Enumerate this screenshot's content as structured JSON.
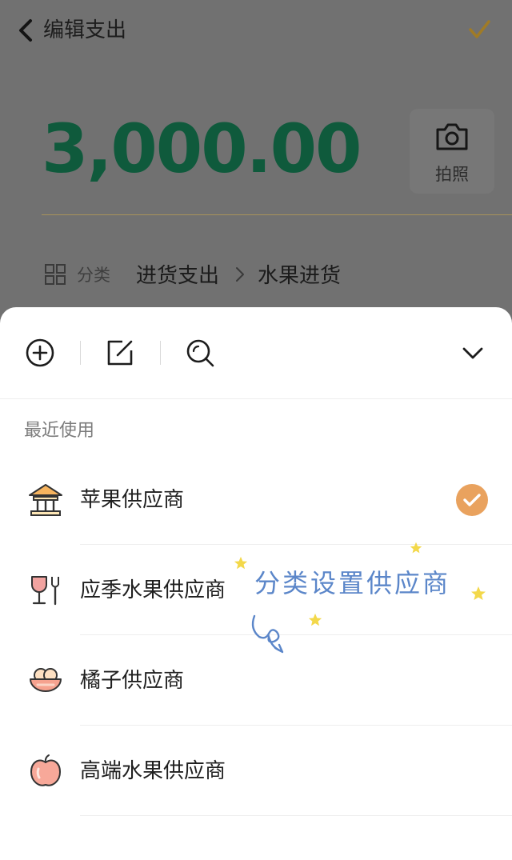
{
  "nav": {
    "title": "编辑支出"
  },
  "amount": {
    "value": "3,000.00"
  },
  "photo": {
    "label": "拍照"
  },
  "category": {
    "label": "分类",
    "main": "进货支出",
    "sub": "水果进货"
  },
  "sheet": {
    "section_title": "最近使用",
    "items": [
      {
        "label": "苹果供应商",
        "icon": "bank-building-icon",
        "selected": true
      },
      {
        "label": "应季水果供应商",
        "icon": "wine-glass-fork-icon",
        "selected": false
      },
      {
        "label": "橘子供应商",
        "icon": "fruit-bowl-icon",
        "selected": false
      },
      {
        "label": "高端水果供应商",
        "icon": "apple-icon",
        "selected": false
      }
    ]
  },
  "overlay": {
    "text": "分类设置供应商"
  },
  "colors": {
    "amount": "#0f5a3c",
    "accent": "#e9a25e",
    "overlay_text": "#5b86c9",
    "star": "#f3d84a"
  }
}
